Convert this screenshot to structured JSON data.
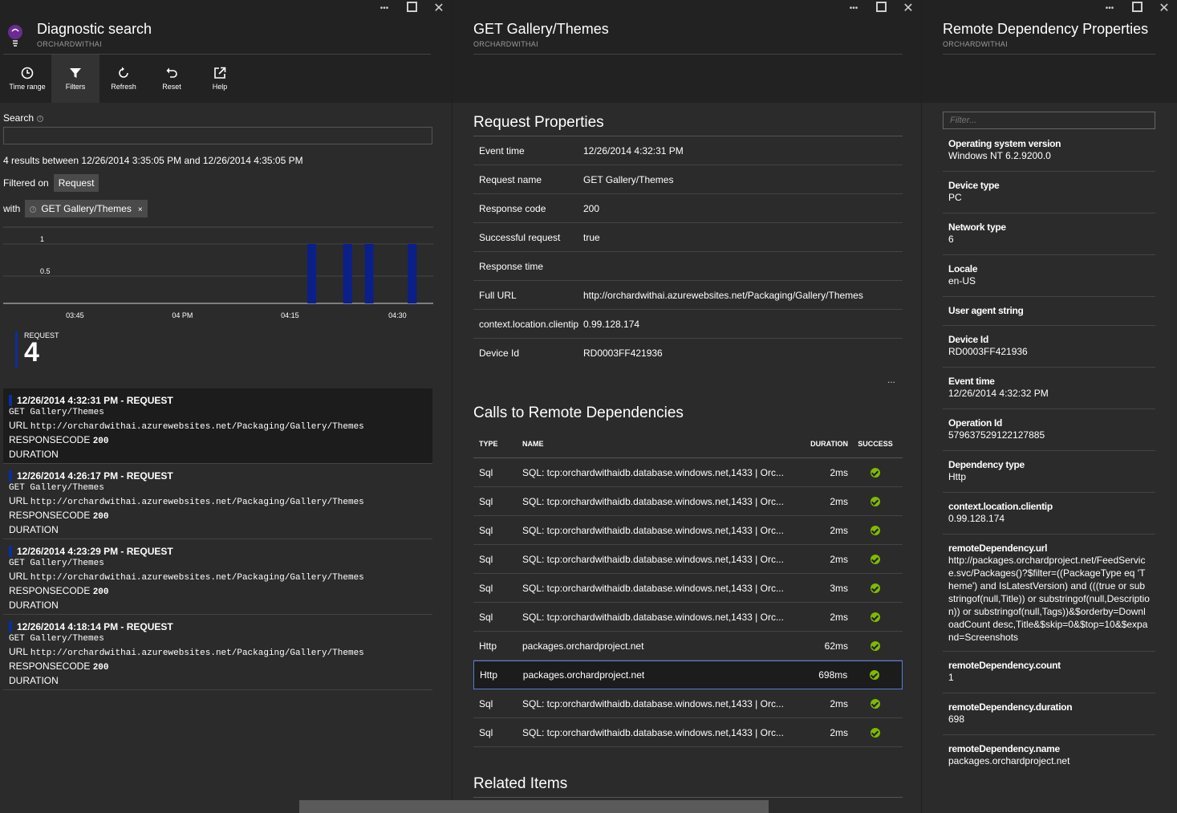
{
  "window_controls": {
    "more": "•••",
    "close": "✕"
  },
  "blade1": {
    "title": "Diagnostic search",
    "subtitle": "ORCHARDWITHAI",
    "toolbar": [
      {
        "label": "Time range",
        "icon": "clock-icon"
      },
      {
        "label": "Filters",
        "icon": "filter-icon"
      },
      {
        "label": "Refresh",
        "icon": "refresh-icon"
      },
      {
        "label": "Reset",
        "icon": "undo-icon"
      },
      {
        "label": "Help",
        "icon": "external-link-icon"
      }
    ],
    "search_label": "Search",
    "results_summary": "4 results between 12/26/2014 3:35:05 PM and 12/26/2014 4:35:05 PM",
    "filtered_on_label": "Filtered on",
    "filtered_on_value": "Request",
    "with_label": "with",
    "with_chip": "GET Gallery/Themes",
    "with_chip_close": "×",
    "count_label": "REQUEST",
    "count_value": "4",
    "results": [
      {
        "title": "12/26/2014 4:32:31 PM - REQUEST",
        "method_path": "GET Gallery/Themes",
        "url_label": "URL",
        "url": "http://orchardwithai.azurewebsites.net/Packaging/Gallery/Themes",
        "code_label": "RESPONSECODE",
        "code": "200",
        "duration_label": "DURATION"
      },
      {
        "title": "12/26/2014 4:26:17 PM - REQUEST",
        "method_path": "GET Gallery/Themes",
        "url_label": "URL",
        "url": "http://orchardwithai.azurewebsites.net/Packaging/Gallery/Themes",
        "code_label": "RESPONSECODE",
        "code": "200",
        "duration_label": "DURATION"
      },
      {
        "title": "12/26/2014 4:23:29 PM - REQUEST",
        "method_path": "GET Gallery/Themes",
        "url_label": "URL",
        "url": "http://orchardwithai.azurewebsites.net/Packaging/Gallery/Themes",
        "code_label": "RESPONSECODE",
        "code": "200",
        "duration_label": "DURATION"
      },
      {
        "title": "12/26/2014 4:18:14 PM - REQUEST",
        "method_path": "GET Gallery/Themes",
        "url_label": "URL",
        "url": "http://orchardwithai.azurewebsites.net/Packaging/Gallery/Themes",
        "code_label": "RESPONSECODE",
        "code": "200",
        "duration_label": "DURATION"
      }
    ]
  },
  "chart_data": {
    "type": "bar",
    "x_ticks": [
      "03:45",
      "04 PM",
      "04:15",
      "04:30"
    ],
    "y_ticks": [
      "0.5",
      "1"
    ],
    "ylim": [
      0,
      1
    ],
    "series": [
      {
        "values": [
          {
            "x": "16:18",
            "y": 1
          },
          {
            "x": "16:23",
            "y": 1
          },
          {
            "x": "16:26",
            "y": 1
          },
          {
            "x": "16:32",
            "y": 1
          }
        ]
      }
    ],
    "xlim": [
      "15:35",
      "16:35"
    ],
    "color": "#0b1f8a"
  },
  "blade2": {
    "title": "GET Gallery/Themes",
    "subtitle": "ORCHARDWITHAI",
    "request_properties_title": "Request Properties",
    "properties": [
      {
        "key": "Event time",
        "value": "12/26/2014 4:32:31 PM"
      },
      {
        "key": "Request name",
        "value": "GET Gallery/Themes"
      },
      {
        "key": "Response code",
        "value": "200"
      },
      {
        "key": "Successful request",
        "value": "true"
      },
      {
        "key": "Response time",
        "value": ""
      },
      {
        "key": "Full URL",
        "value": "http://orchardwithai.azurewebsites.net/Packaging/Gallery/Themes"
      },
      {
        "key": "context.location.clientip",
        "value": "0.99.128.174"
      },
      {
        "key": "Device Id",
        "value": "RD0003FF421936"
      }
    ],
    "more": "...",
    "deps_title": "Calls to Remote Dependencies",
    "deps_headers": {
      "type": "TYPE",
      "name": "NAME",
      "duration": "DURATION",
      "success": "SUCCESS"
    },
    "deps": [
      {
        "type": "Sql",
        "name": "SQL: tcp:orchardwithaidb.database.windows.net,1433 | Orc...",
        "duration": "2ms"
      },
      {
        "type": "Sql",
        "name": "SQL: tcp:orchardwithaidb.database.windows.net,1433 | Orc...",
        "duration": "2ms"
      },
      {
        "type": "Sql",
        "name": "SQL: tcp:orchardwithaidb.database.windows.net,1433 | Orc...",
        "duration": "2ms"
      },
      {
        "type": "Sql",
        "name": "SQL: tcp:orchardwithaidb.database.windows.net,1433 | Orc...",
        "duration": "2ms"
      },
      {
        "type": "Sql",
        "name": "SQL: tcp:orchardwithaidb.database.windows.net,1433 | Orc...",
        "duration": "3ms"
      },
      {
        "type": "Sql",
        "name": "SQL: tcp:orchardwithaidb.database.windows.net,1433 | Orc...",
        "duration": "2ms"
      },
      {
        "type": "Http",
        "name": "packages.orchardproject.net",
        "duration": "62ms"
      },
      {
        "type": "Http",
        "name": "packages.orchardproject.net",
        "duration": "698ms"
      },
      {
        "type": "Sql",
        "name": "SQL: tcp:orchardwithaidb.database.windows.net,1433 | Orc...",
        "duration": "2ms"
      },
      {
        "type": "Sql",
        "name": "SQL: tcp:orchardwithaidb.database.windows.net,1433 | Orc...",
        "duration": "2ms"
      }
    ],
    "related_title": "Related Items"
  },
  "blade3": {
    "title": "Remote Dependency Properties",
    "subtitle": "ORCHARDWITHAI",
    "filter_placeholder": "Filter...",
    "properties": [
      {
        "key": "Operating system version",
        "value": "Windows NT 6.2.9200.0"
      },
      {
        "key": "Device type",
        "value": "PC"
      },
      {
        "key": "Network type",
        "value": "6"
      },
      {
        "key": "Locale",
        "value": "en-US"
      },
      {
        "key": "User agent string",
        "value": ""
      },
      {
        "key": "Device Id",
        "value": "RD0003FF421936"
      },
      {
        "key": "Event time",
        "value": "12/26/2014 4:32:32 PM"
      },
      {
        "key": "Operation Id",
        "value": "579637529122127885"
      },
      {
        "key": "Dependency type",
        "value": "Http"
      },
      {
        "key": "context.location.clientip",
        "value": "0.99.128.174"
      },
      {
        "key": "remoteDependency.url",
        "value": "http://packages.orchardproject.net/FeedService.svc/Packages()?$filter=((PackageType eq 'Theme') and IsLatestVersion) and (((true or substringof(null,Title)) or substringof(null,Description)) or substringof(null,Tags))&$orderby=DownloadCount desc,Title&$skip=0&$top=10&$expand=Screenshots"
      },
      {
        "key": "remoteDependency.count",
        "value": "1"
      },
      {
        "key": "remoteDependency.duration",
        "value": "698"
      },
      {
        "key": "remoteDependency.name",
        "value": "packages.orchardproject.net"
      }
    ]
  }
}
